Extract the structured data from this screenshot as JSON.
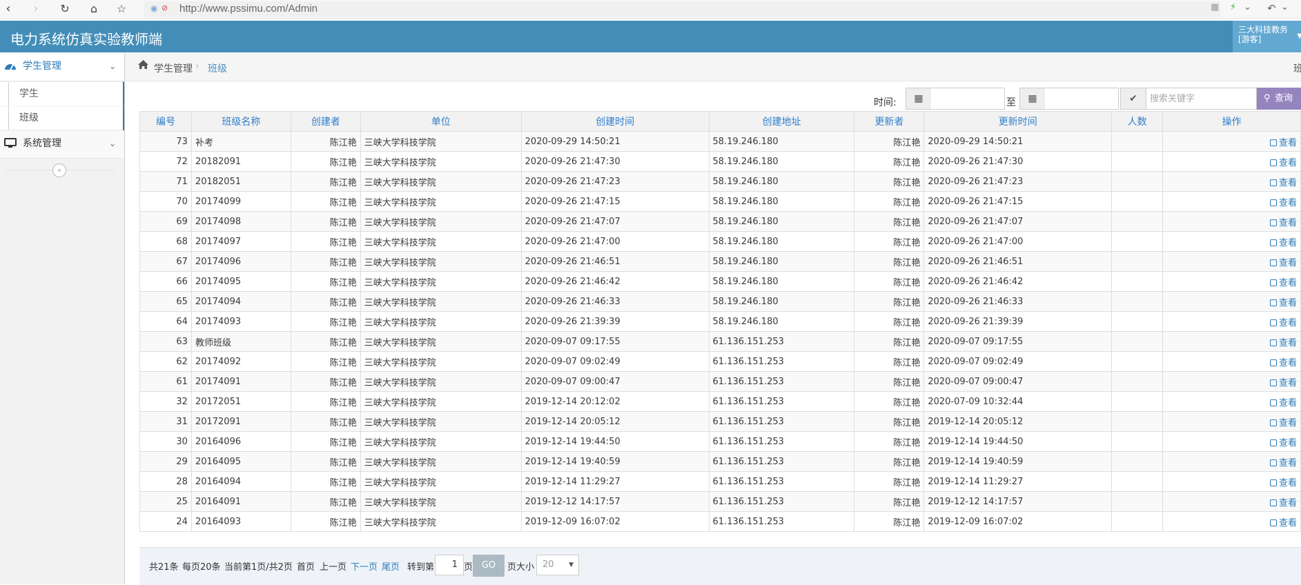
{
  "browser": {
    "url": "http://www.pssimu.com/Admin"
  },
  "header": {
    "title": "电力系统仿真实验教师端",
    "user_line1": "三大科技教务",
    "user_line2": "[游客]"
  },
  "sidebar": {
    "groups": [
      {
        "label": "学生管理",
        "items": [
          {
            "label": "学生"
          },
          {
            "label": "班级"
          }
        ]
      },
      {
        "label": "系统管理"
      }
    ],
    "collapse_glyph": "«"
  },
  "breadcrumb": {
    "items": [
      "学生管理",
      "班级"
    ],
    "right_text": "班"
  },
  "search": {
    "time_label": "时间:",
    "to_label": "至",
    "start_date": "",
    "end_date": "",
    "keyword_placeholder": "搜索关键字",
    "keyword_value": "",
    "search_label": "查询"
  },
  "table": {
    "columns": [
      "编号",
      "班级名称",
      "创建者",
      "单位",
      "创建时间",
      "创建地址",
      "更新者",
      "更新时间",
      "人数",
      "操作"
    ],
    "action_label": "查看",
    "rows": [
      [
        "73",
        "补考",
        "陈江艳",
        "三峡大学科技学院",
        "2020-09-29 14:50:21",
        "58.19.246.180",
        "陈江艳",
        "2020-09-29 14:50:21",
        ""
      ],
      [
        "72",
        "20182091",
        "陈江艳",
        "三峡大学科技学院",
        "2020-09-26 21:47:30",
        "58.19.246.180",
        "陈江艳",
        "2020-09-26 21:47:30",
        ""
      ],
      [
        "71",
        "20182051",
        "陈江艳",
        "三峡大学科技学院",
        "2020-09-26 21:47:23",
        "58.19.246.180",
        "陈江艳",
        "2020-09-26 21:47:23",
        ""
      ],
      [
        "70",
        "20174099",
        "陈江艳",
        "三峡大学科技学院",
        "2020-09-26 21:47:15",
        "58.19.246.180",
        "陈江艳",
        "2020-09-26 21:47:15",
        ""
      ],
      [
        "69",
        "20174098",
        "陈江艳",
        "三峡大学科技学院",
        "2020-09-26 21:47:07",
        "58.19.246.180",
        "陈江艳",
        "2020-09-26 21:47:07",
        ""
      ],
      [
        "68",
        "20174097",
        "陈江艳",
        "三峡大学科技学院",
        "2020-09-26 21:47:00",
        "58.19.246.180",
        "陈江艳",
        "2020-09-26 21:47:00",
        ""
      ],
      [
        "67",
        "20174096",
        "陈江艳",
        "三峡大学科技学院",
        "2020-09-26 21:46:51",
        "58.19.246.180",
        "陈江艳",
        "2020-09-26 21:46:51",
        ""
      ],
      [
        "66",
        "20174095",
        "陈江艳",
        "三峡大学科技学院",
        "2020-09-26 21:46:42",
        "58.19.246.180",
        "陈江艳",
        "2020-09-26 21:46:42",
        ""
      ],
      [
        "65",
        "20174094",
        "陈江艳",
        "三峡大学科技学院",
        "2020-09-26 21:46:33",
        "58.19.246.180",
        "陈江艳",
        "2020-09-26 21:46:33",
        ""
      ],
      [
        "64",
        "20174093",
        "陈江艳",
        "三峡大学科技学院",
        "2020-09-26 21:39:39",
        "58.19.246.180",
        "陈江艳",
        "2020-09-26 21:39:39",
        ""
      ],
      [
        "63",
        "教师班级",
        "陈江艳",
        "三峡大学科技学院",
        "2020-09-07 09:17:55",
        "61.136.151.253",
        "陈江艳",
        "2020-09-07 09:17:55",
        ""
      ],
      [
        "62",
        "20174092",
        "陈江艳",
        "三峡大学科技学院",
        "2020-09-07 09:02:49",
        "61.136.151.253",
        "陈江艳",
        "2020-09-07 09:02:49",
        ""
      ],
      [
        "61",
        "20174091",
        "陈江艳",
        "三峡大学科技学院",
        "2020-09-07 09:00:47",
        "61.136.151.253",
        "陈江艳",
        "2020-09-07 09:00:47",
        ""
      ],
      [
        "32",
        "20172051",
        "陈江艳",
        "三峡大学科技学院",
        "2019-12-14 20:12:02",
        "61.136.151.253",
        "陈江艳",
        "2020-07-09 10:32:44",
        ""
      ],
      [
        "31",
        "20172091",
        "陈江艳",
        "三峡大学科技学院",
        "2019-12-14 20:05:12",
        "61.136.151.253",
        "陈江艳",
        "2019-12-14 20:05:12",
        ""
      ],
      [
        "30",
        "20164096",
        "陈江艳",
        "三峡大学科技学院",
        "2019-12-14 19:44:50",
        "61.136.151.253",
        "陈江艳",
        "2019-12-14 19:44:50",
        ""
      ],
      [
        "29",
        "20164095",
        "陈江艳",
        "三峡大学科技学院",
        "2019-12-14 19:40:59",
        "61.136.151.253",
        "陈江艳",
        "2019-12-14 19:40:59",
        ""
      ],
      [
        "28",
        "20164094",
        "陈江艳",
        "三峡大学科技学院",
        "2019-12-14 11:29:27",
        "61.136.151.253",
        "陈江艳",
        "2019-12-14 11:29:27",
        ""
      ],
      [
        "25",
        "20164091",
        "陈江艳",
        "三峡大学科技学院",
        "2019-12-12 14:17:57",
        "61.136.151.253",
        "陈江艳",
        "2019-12-12 14:17:57",
        ""
      ],
      [
        "24",
        "20164093",
        "陈江艳",
        "三峡大学科技学院",
        "2019-12-09 16:07:02",
        "61.136.151.253",
        "陈江艳",
        "2019-12-09 16:07:02",
        ""
      ]
    ]
  },
  "pager": {
    "total": "共21条",
    "per_page": "每页20条",
    "current": "当前第1页/共2页",
    "first": "首页",
    "prev": "上一页",
    "next": "下一页",
    "last": "尾页",
    "goto_label": "转到第",
    "goto_value": "1",
    "page_unit": "页",
    "go_label": "GO",
    "size_label": "页大小",
    "size_value": "20"
  },
  "colors": {
    "header_bg": "#438eb9",
    "user_box_bg": "#62a8d1",
    "search_btn_bg": "#9585bf",
    "link": "#2b7dbc",
    "th_text": "#307ecc",
    "go_btn_bg": "#abbac3"
  },
  "icons": {
    "back": "back-arrow-icon",
    "forward": "forward-arrow-icon",
    "reload": "reload-icon",
    "home": "home-icon",
    "bookmark": "star-icon",
    "sidebar_students": "tachometer-icon",
    "sidebar_system": "desktop-icon",
    "breadcrumb_home": "home-icon",
    "calendar": "calendar-icon",
    "check": "check-icon",
    "search": "search-icon",
    "view": "edit-icon"
  }
}
